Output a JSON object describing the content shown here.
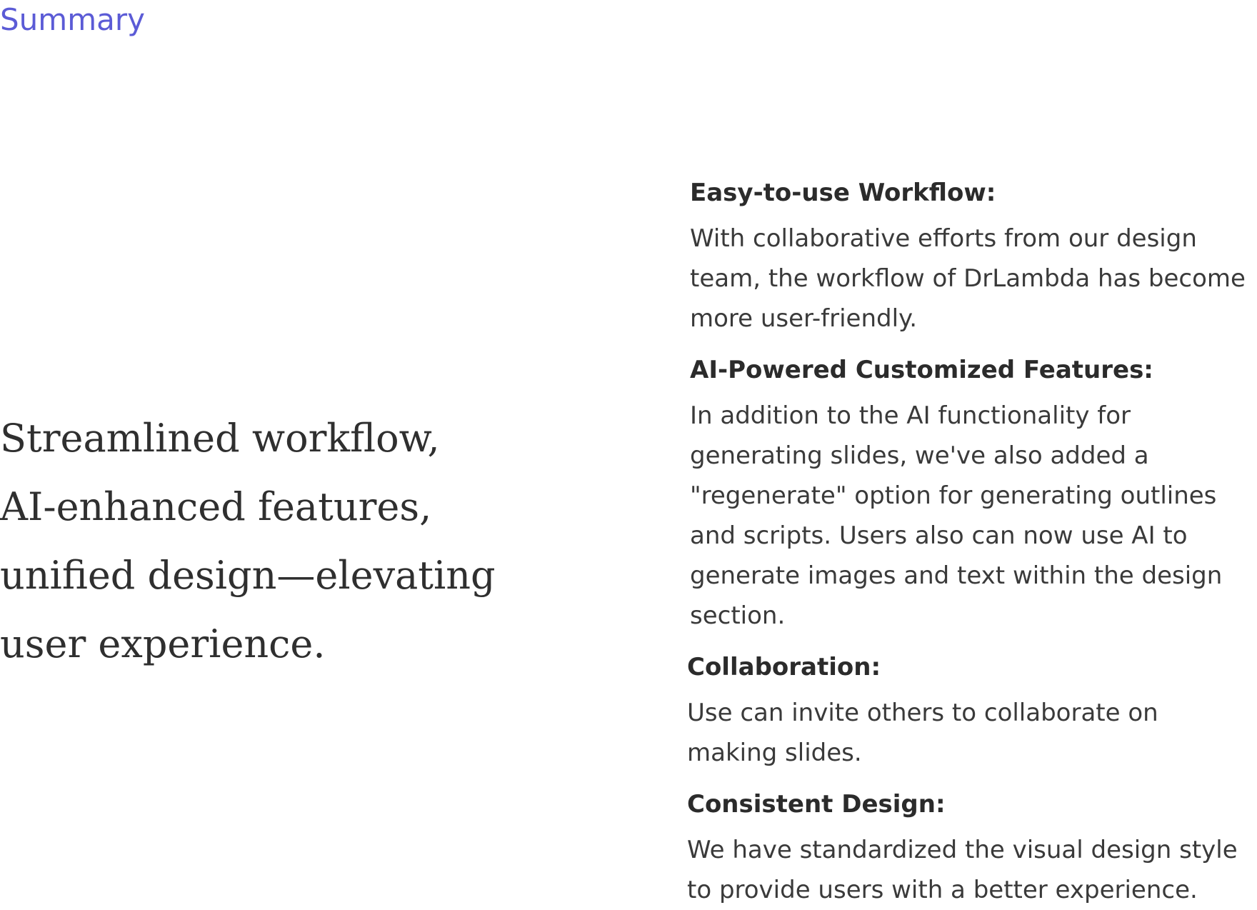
{
  "section_label": "Summary",
  "tagline_lines": [
    "Streamlined workflow,",
    "AI-enhanced features,",
    "unified design—elevating",
    "user experience."
  ],
  "features": [
    {
      "title": "Easy-to-use Workflow:",
      "lines": [
        "With collaborative efforts from our design",
        "team, the workflow of DrLambda has become",
        "more user-friendly."
      ]
    },
    {
      "title": "AI-Powered Customized Features:",
      "lines": [
        "In addition to the AI functionality for",
        "generating slides, we've also added a",
        "\"regenerate\" option for generating outlines",
        "and scripts. Users also can now use AI to",
        "generate images and text within the design",
        "section."
      ]
    },
    {
      "title": "Collaboration:",
      "lines": [
        "Use can invite others to collaborate on",
        "making slides."
      ]
    },
    {
      "title": "Consistent Design:",
      "lines": [
        "We have standardized the visual design style",
        "to provide users with a better experience."
      ]
    }
  ],
  "colors": {
    "accent": "#5b5bd6",
    "text": "#333333",
    "background": "#ffffff"
  }
}
